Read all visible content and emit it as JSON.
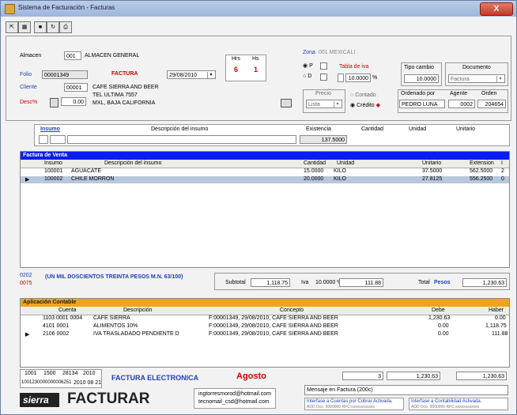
{
  "window": {
    "title": "Sistema de Facturación - Facturas",
    "close_label": "X"
  },
  "toolbar": [
    "export",
    "grid",
    "save",
    "refresh",
    "print"
  ],
  "header": {
    "almacen_label": "Almacen",
    "almacen_code": "001",
    "almacen_name": "ALMACEN GENERAL",
    "folio_label": "Folio",
    "folio_value": "00001349",
    "doc_type": "FACTURA",
    "date": "29/08/2010",
    "cliente_label": "Cliente",
    "cliente_code": "00001",
    "cliente_name": "CAFE SIERRA AND BEER",
    "cliente_addr1": "TEL ULTIMA 7557",
    "cliente_addr2": "MXL, BAJA CALIFORNIA",
    "desc_label": "Desc%",
    "desc_value": "0.00",
    "hrs_label": "Hrs",
    "hrs_value": "6",
    "hs_label": "Hs",
    "hs_value": "1"
  },
  "right_panel": {
    "zona_label": "Zona",
    "zona_value": "001 MEXICALI",
    "p_label": "P",
    "d_label": "D",
    "tabla_iva_label": "Tabla de iva",
    "iva_value": "10.0000",
    "iva_unit": "%",
    "tipo_cambio_label": "Tipo cambio",
    "tipo_cambio_value": "10.0000",
    "documento_label": "Documento",
    "documento_value": "Factura",
    "precio_label": "Precio",
    "precio_value": "Lista",
    "contado_label": "Contado",
    "credito_label": "Crédito",
    "ordenado_label": "Ordenado por",
    "ordenado_value": "PEDRO LUNA",
    "agente_label": "Agente",
    "agente_value": "0002",
    "orden_label": "Orden",
    "orden_value": "204654"
  },
  "insumo_entry": {
    "insumo_label": "Insumo",
    "desc_label": "Descripción del insumo",
    "existencia_label": "Existencia",
    "existencia_value": "137.5000",
    "cantidad_label": "Cantidad",
    "unidad_label": "Unidad",
    "unitario_label": "Unitario"
  },
  "detail": {
    "title": "Factura de Venta",
    "columns": [
      "Insumo",
      "Descripción del insumo",
      "Cantidad",
      "Unidad",
      "Unitario",
      "Extension",
      "I"
    ],
    "rows": [
      {
        "marker": "",
        "insumo": "100001",
        "desc": "AGUACATE",
        "cantidad": "15.0000",
        "unidad": "KILO",
        "unitario": "37.5000",
        "extension": "562.5000",
        "i": "2"
      },
      {
        "marker": "▶",
        "insumo": "100002",
        "desc": "CHILE MORRON",
        "cantidad": "20.0000",
        "unidad": "KILO",
        "unitario": "27.8125",
        "extension": "556.2500",
        "i": "0"
      }
    ]
  },
  "totals": {
    "code1": "0202",
    "code2": "0075",
    "letter_amount": "(UN MIL DOSCIENTOS TREINTA PESOS M.N. 63/100)",
    "subtotal_label": "Subtotal",
    "subtotal_value": "1,118.75",
    "iva_label": "Iva",
    "iva_pct": "10.0000 %",
    "iva_value": "111.88",
    "total_label": "Total",
    "currency": "Pesos",
    "total_value": "1,230.63"
  },
  "accounting": {
    "title": "Aplicación Contable",
    "columns": [
      "Cuenta",
      "Descripción",
      "Concepto",
      "Debe",
      "Haber"
    ],
    "rows": [
      {
        "marker": "",
        "cuenta": "1103 0001 0004",
        "desc": "CAFE SIERRA",
        "concepto": "F:00001349, 29/08/2010, CAFE SIERRA AND BEER",
        "debe": "1,230.63",
        "haber": "0.00"
      },
      {
        "marker": "",
        "cuenta": "4101 0001",
        "desc": "ALIMENTOS 10%",
        "concepto": "F:00001349, 29/08/2010, CAFE SIERRA AND BEER",
        "debe": "0.00",
        "haber": "1,118.75"
      },
      {
        "marker": "▶",
        "cuenta": "2106 0002",
        "desc": "IVA TRASLADADO PENDIENTE D",
        "concepto": "F:00001349, 29/08/2010, CAFE SIERRA AND BEER",
        "debe": "0.00",
        "haber": "111.88"
      }
    ],
    "count": "3",
    "total_debe": "1,230.63",
    "total_haber": "1,230.63"
  },
  "footer": {
    "n1": "1001",
    "n2": "1500",
    "n3": "28134",
    "n4": "2010",
    "serie": "1001230000000006251",
    "fecha": "2010 08 21",
    "electronica": "FACTURA ELECTRONICA",
    "mes": "Agosto",
    "brand": "sierra",
    "product": "FACTURAR",
    "email1": "ingtorresmorod@hotmail.com",
    "email2": "tecnomail_csd@hotmail.com",
    "mensaje": "Mensaje en Factura (200c)",
    "status1_title": "Interfase a Cuentas por Cobrar Activada.",
    "status1_sub": "ADD Dco. 0000000 RFC:xxxxxxxxxxxx",
    "status2_title": "Interfase a Contabilidad Activada.",
    "status2_sub": "ADD Dco. 0000000 RFC:xxxxxxxxxxxx"
  }
}
